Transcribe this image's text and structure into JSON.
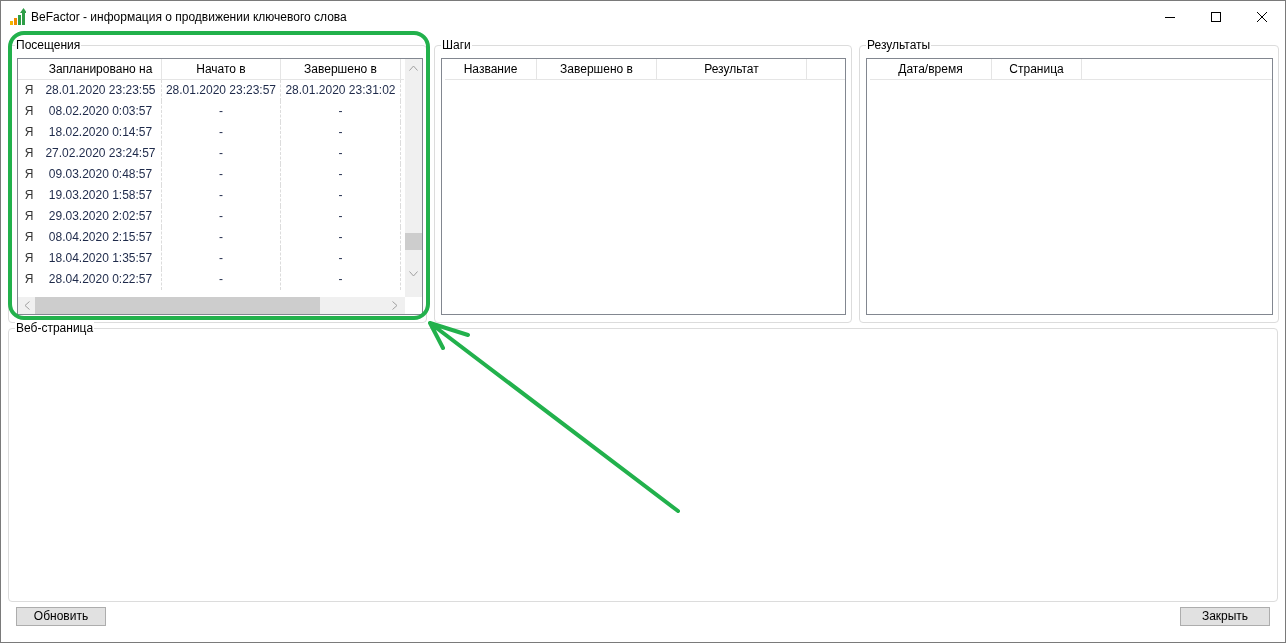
{
  "window": {
    "title": "BeFactor - информация о продвижении ключевого слова"
  },
  "visits": {
    "title": "Посещения",
    "columns": [
      "Запланировано на",
      "Начато в",
      "Завершено в"
    ],
    "rows": [
      {
        "marker": "Я",
        "cells": [
          "28.01.2020 23:23:55",
          "28.01.2020 23:23:57",
          "28.01.2020 23:31:02"
        ]
      },
      {
        "marker": "Я",
        "cells": [
          "08.02.2020 0:03:57",
          "-",
          "-"
        ]
      },
      {
        "marker": "Я",
        "cells": [
          "18.02.2020 0:14:57",
          "-",
          "-"
        ]
      },
      {
        "marker": "Я",
        "cells": [
          "27.02.2020 23:24:57",
          "-",
          "-"
        ]
      },
      {
        "marker": "Я",
        "cells": [
          "09.03.2020 0:48:57",
          "-",
          "-"
        ]
      },
      {
        "marker": "Я",
        "cells": [
          "19.03.2020 1:58:57",
          "-",
          "-"
        ]
      },
      {
        "marker": "Я",
        "cells": [
          "29.03.2020 2:02:57",
          "-",
          "-"
        ]
      },
      {
        "marker": "Я",
        "cells": [
          "08.04.2020 2:15:57",
          "-",
          "-"
        ]
      },
      {
        "marker": "Я",
        "cells": [
          "18.04.2020 1:35:57",
          "-",
          "-"
        ]
      },
      {
        "marker": "Я",
        "cells": [
          "28.04.2020 0:22:57",
          "-",
          "-"
        ]
      }
    ]
  },
  "steps": {
    "title": "Шаги",
    "columns": [
      "Название",
      "Завершено в",
      "Результат"
    ]
  },
  "results": {
    "title": "Результаты",
    "columns": [
      "Дата/время",
      "Страница"
    ]
  },
  "web_page": {
    "title": "Веб-страница"
  },
  "buttons": {
    "refresh": "Обновить",
    "close": "Закрыть"
  }
}
